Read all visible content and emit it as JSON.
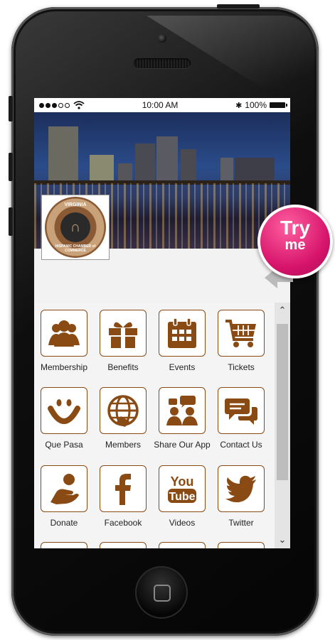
{
  "status": {
    "time": "10:00 AM",
    "battery": "100%"
  },
  "logo": {
    "text_top": "VIRGINIA",
    "text_bottom": "HISPANIC CHAMBER of COMMERCE"
  },
  "badge": {
    "line1": "Try",
    "line2": "me"
  },
  "tiles": [
    {
      "label": "Membership",
      "icon": "members-group-icon"
    },
    {
      "label": "Benefits",
      "icon": "gift-icon"
    },
    {
      "label": "Events",
      "icon": "calendar-icon"
    },
    {
      "label": "Tickets",
      "icon": "cart-icon"
    },
    {
      "label": "Que Pasa",
      "icon": "smile-icon"
    },
    {
      "label": "Members",
      "icon": "globe-icon"
    },
    {
      "label": "Share Our App",
      "icon": "share-people-icon"
    },
    {
      "label": "Contact Us",
      "icon": "chat-bubbles-icon"
    },
    {
      "label": "Donate",
      "icon": "donate-hand-icon"
    },
    {
      "label": "Facebook",
      "icon": "facebook-icon"
    },
    {
      "label": "Videos",
      "icon": "youtube-icon"
    },
    {
      "label": "Twitter",
      "icon": "twitter-icon"
    }
  ],
  "colors": {
    "accent": "#8a4a14",
    "badge": "#d6136a"
  }
}
